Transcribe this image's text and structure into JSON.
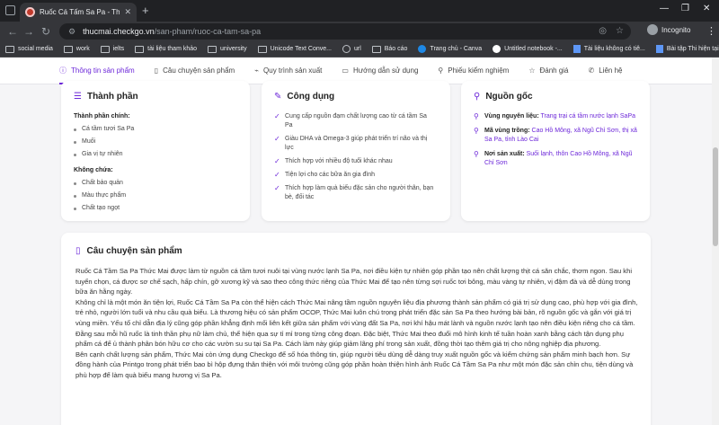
{
  "browser": {
    "tab_title": "Ruốc Cá Tấm Sa Pa - Thức Mai",
    "url_host": "thucmai.checkgo.vn",
    "url_path": "/san-pham/ruoc-ca-tam-sa-pa",
    "incognito_label": "Incognito",
    "bookmarks": [
      {
        "icon": "folder-icon",
        "label": "social media"
      },
      {
        "icon": "folder-icon",
        "label": "work"
      },
      {
        "icon": "folder-icon",
        "label": "ielts"
      },
      {
        "icon": "folder-icon",
        "label": "tài liệu tham khảo"
      },
      {
        "icon": "folder-icon",
        "label": "university"
      },
      {
        "icon": "folder-icon",
        "label": "Unicode Text Conve..."
      },
      {
        "icon": "globe-icon",
        "label": "url"
      },
      {
        "icon": "folder-icon",
        "label": "Báo cáo"
      },
      {
        "icon": "canva-icon",
        "label": "Trang chủ - Canva"
      },
      {
        "icon": "colab-icon",
        "label": "Untitled notebook -..."
      },
      {
        "icon": "doc-icon",
        "label": "Tài liệu không có tiê..."
      },
      {
        "icon": "doc-icon",
        "label": "Bài tập Thi hiện tại t..."
      }
    ]
  },
  "subnav": [
    {
      "icon": "info-icon",
      "glyph": "ⓘ",
      "label": "Thông tin sản phẩm",
      "active": true
    },
    {
      "icon": "book-icon",
      "glyph": "▯",
      "label": "Câu chuyện sản phẩm",
      "active": false
    },
    {
      "icon": "process-icon",
      "glyph": "⌁",
      "label": "Quy trình sản xuất",
      "active": false
    },
    {
      "icon": "guide-icon",
      "glyph": "▭",
      "label": "Hướng dẫn sử dụng",
      "active": false
    },
    {
      "icon": "test-icon",
      "glyph": "⚲",
      "label": "Phiếu kiểm nghiệm",
      "active": false
    },
    {
      "icon": "star-icon",
      "glyph": "☆",
      "label": "Đánh giá",
      "active": false
    },
    {
      "icon": "phone-icon",
      "glyph": "✆",
      "label": "Liên hệ",
      "active": false
    }
  ],
  "ingredients": {
    "title": "Thành phần",
    "main_label": "Thành phần chính:",
    "main_items": [
      "Cá tầm tươi Sa Pa",
      "Muối",
      "Gia vị tự nhiên"
    ],
    "none_label": "Không chứa:",
    "none_items": [
      "Chất bảo quản",
      "Màu thực phẩm",
      "Chất tạo ngọt"
    ]
  },
  "uses": {
    "title": "Công dụng",
    "items": [
      "Cung cấp nguồn đạm chất lượng cao từ cá tầm Sa Pa",
      "Giàu DHA và Omega-3 giúp phát triển trí não và thị lực",
      "Thích hợp với nhiều độ tuổi khác nhau",
      "Tiện lợi cho các bữa ăn gia đình",
      "Thích hợp làm quà biếu đặc sản cho người thân, bạn bè, đối tác"
    ]
  },
  "origin": {
    "title": "Nguồn gốc",
    "rows": [
      {
        "label": "Vùng nguyên liệu:",
        "value": "Trang trại cá tầm nước lạnh SaPa"
      },
      {
        "label": "Mã vùng trồng:",
        "value": "Cao Hồ Mông, xã Ngũ Chỉ Sơn, thị xã Sa Pa, tỉnh Lào Cai"
      },
      {
        "label": "Nơi sản xuất:",
        "value": "Suối lạnh, thôn Cao Hồ Mông, xã Ngũ Chỉ Sơn"
      }
    ]
  },
  "story": {
    "title": "Câu chuyện sản phẩm",
    "paragraphs": [
      "Ruốc Cá Tầm Sa Pa Thức Mai được làm từ nguồn cá tầm tươi nuôi tại vùng nước lạnh Sa Pa, nơi điều kiện tự nhiên góp phần tạo nên chất lượng thịt cá săn chắc, thơm ngon. Sau khi tuyển chọn, cá được sơ chế sạch, hấp chín, gỡ xương kỹ và sao theo công thức riêng của Thức Mai để tạo nên từng sợi ruốc tơi bông, màu vàng tự nhiên, vị đậm đà và dễ dùng trong bữa ăn hằng ngày.",
      "Không chỉ là một món ăn tiện lợi, Ruốc Cá Tầm Sa Pa còn thể hiện cách Thức Mai nâng tầm nguồn nguyên liệu địa phương thành sản phẩm có giá trị sử dụng cao, phù hợp với gia đình, trẻ nhỏ, người lớn tuổi và nhu cầu quà biếu. Là thương hiệu có sản phẩm OCOP, Thức Mai luôn chú trọng phát triển đặc sản Sa Pa theo hướng bài bản, rõ nguồn gốc và gắn với giá trị vùng miền. Yếu tố chỉ dẫn địa lý cũng góp phần khẳng định mối liên kết giữa sản phẩm với vùng đất Sa Pa, nơi khí hậu mát lành và nguồn nước lạnh tạo nên điều kiện riêng cho cá tầm.",
      "Đằng sau mỗi hũ ruốc là tinh thần phụ nữ làm chủ, thể hiện qua sự tỉ mỉ trong từng công đoạn. Đặc biệt, Thức Mai theo đuổi mô hình kinh tế tuần hoàn xanh bằng cách tận dụng phụ phẩm cá để ủ thành phân bón hữu cơ cho các vườn su su tại Sa Pa. Cách làm này giúp giảm lãng phí trong sản xuất, đồng thời tạo thêm giá trị cho nông nghiệp địa phương.",
      "Bên cạnh chất lượng sản phẩm, Thức Mai còn ứng dụng Checkgo để số hóa thông tin, giúp người tiêu dùng dễ dàng truy xuất nguồn gốc và kiểm chứng sản phẩm minh bạch hơn. Sự đồng hành của Printgo trong phát triển bao bì hộp đựng thân thiện với môi trường cũng góp phần hoàn thiện hình ảnh Ruốc Cá Tầm Sa Pa như một món đặc sản chỉn chu, tiện dùng và phù hợp để làm quà biếu mang hương vị Sa Pa."
    ]
  }
}
